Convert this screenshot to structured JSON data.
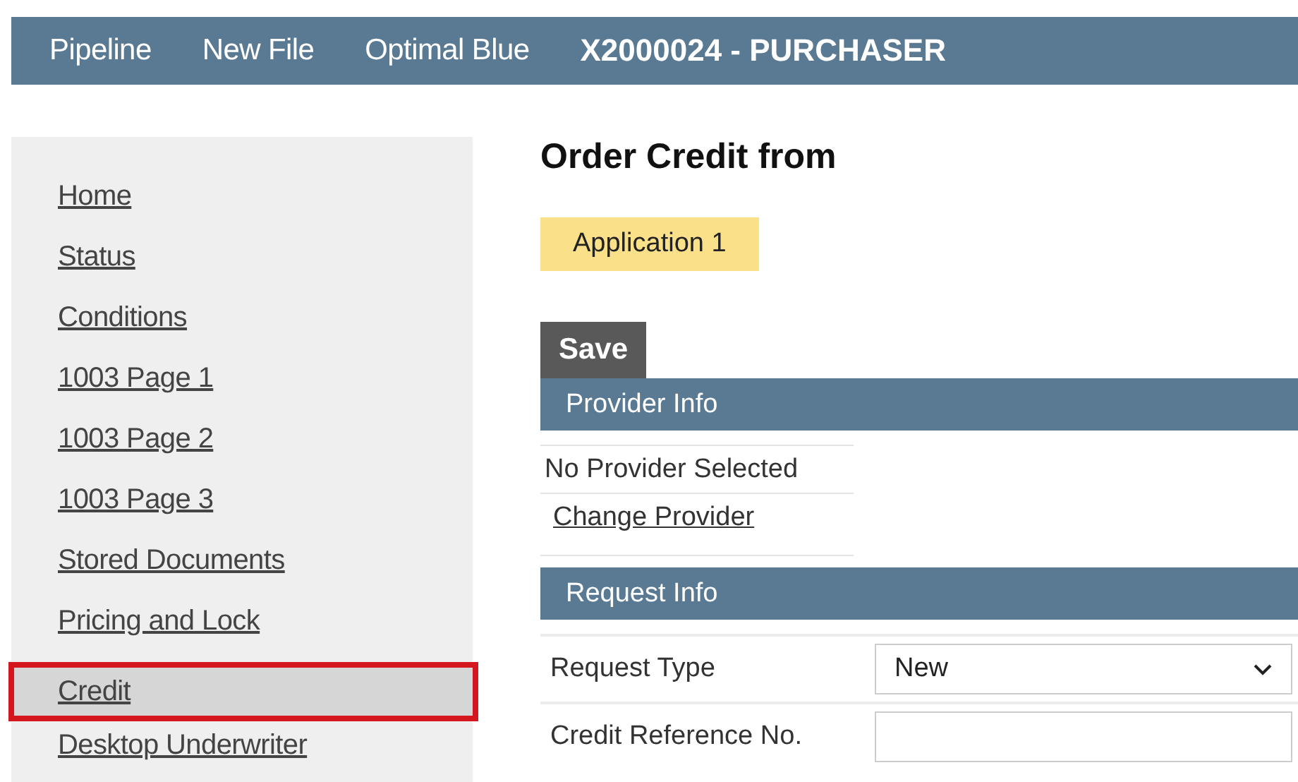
{
  "top_nav": {
    "links": [
      "Pipeline",
      "New File",
      "Optimal Blue"
    ],
    "file_title": "X2000024 - PURCHASER"
  },
  "sidebar": {
    "items": [
      {
        "label": "Home",
        "selected": false
      },
      {
        "label": "Status",
        "selected": false
      },
      {
        "label": "Conditions",
        "selected": false
      },
      {
        "label": "1003 Page 1",
        "selected": false
      },
      {
        "label": "1003 Page 2",
        "selected": false
      },
      {
        "label": "1003 Page 3",
        "selected": false
      },
      {
        "label": "Stored Documents",
        "selected": false
      },
      {
        "label": "Pricing and Lock",
        "selected": false
      },
      {
        "label": "Credit",
        "selected": true
      },
      {
        "label": "Desktop Underwriter",
        "selected": false
      }
    ]
  },
  "page": {
    "title": "Order Credit from",
    "tabs": [
      {
        "label": "Application 1",
        "selected": true
      }
    ],
    "save_button": "Save",
    "provider_section": {
      "header": "Provider Info",
      "status": "No Provider Selected",
      "link": "Change Provider"
    },
    "request_section": {
      "header": "Request Info",
      "fields": [
        {
          "label": "Request Type",
          "kind": "select",
          "value": "New"
        },
        {
          "label": "Credit Reference No.",
          "kind": "text"
        }
      ]
    }
  }
}
